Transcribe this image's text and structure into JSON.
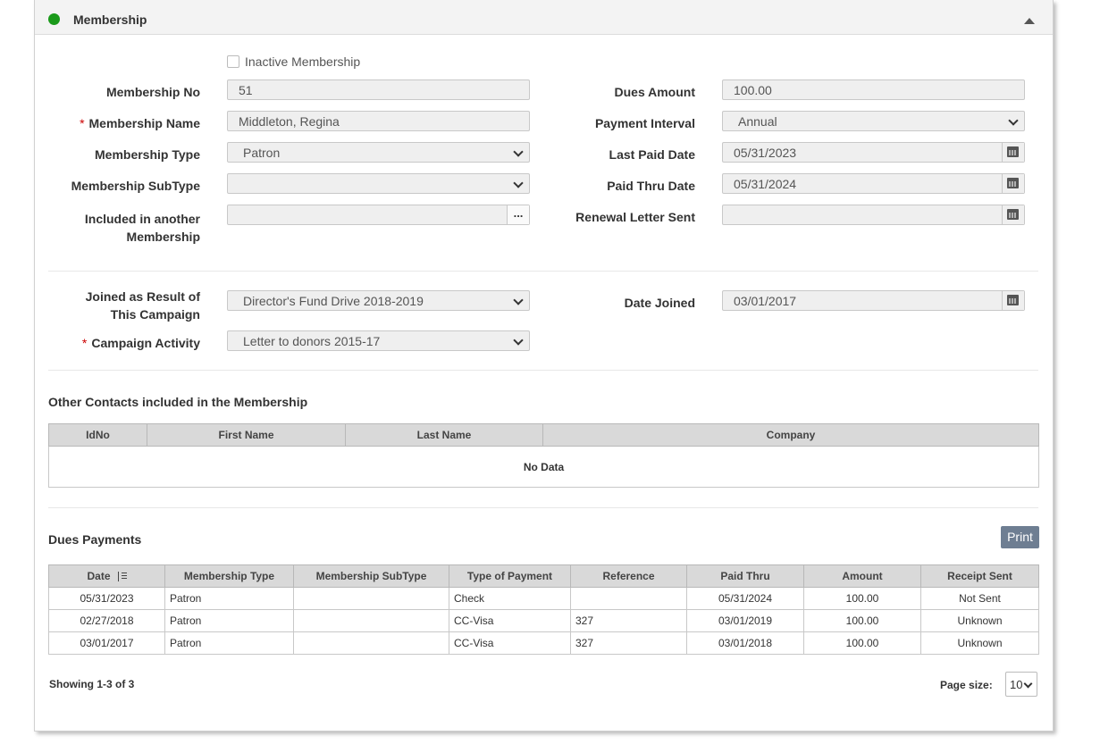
{
  "header": {
    "title": "Membership",
    "status_color": "#1a9a1a"
  },
  "form": {
    "inactive_label": "Inactive Membership",
    "membership_no_label": "Membership No",
    "membership_no": "51",
    "membership_name_label": "Membership Name",
    "membership_name": "Middleton, Regina",
    "membership_type_label": "Membership Type",
    "membership_type": "Patron",
    "membership_subtype_label": "Membership SubType",
    "membership_subtype": "",
    "included_label_1": "Included in another",
    "included_label_2": "Membership",
    "included": "",
    "dues_amount_label": "Dues Amount",
    "dues_amount": "100.00",
    "payment_interval_label": "Payment Interval",
    "payment_interval": "Annual",
    "last_paid_label": "Last Paid Date",
    "last_paid": "05/31/2023",
    "paid_thru_label": "Paid Thru Date",
    "paid_thru": "05/31/2024",
    "renewal_label": "Renewal Letter Sent",
    "renewal": "",
    "campaign_label_1": "Joined as Result of",
    "campaign_label_2": "This Campaign",
    "campaign": "Director's Fund Drive 2018-2019",
    "activity_label": "Campaign Activity",
    "activity": "Letter to donors 2015-17",
    "date_joined_label": "Date Joined",
    "date_joined": "03/01/2017",
    "required_mark": "*"
  },
  "contacts": {
    "title": "Other Contacts included in the Membership",
    "columns": [
      "IdNo",
      "First Name",
      "Last Name",
      "Company"
    ],
    "empty": "No Data"
  },
  "dues": {
    "title": "Dues Payments",
    "print_label": "Print",
    "columns": [
      "Date",
      "Membership Type",
      "Membership SubType",
      "Type of Payment",
      "Reference",
      "Paid Thru",
      "Amount",
      "Receipt Sent"
    ],
    "rows": [
      {
        "date": "05/31/2023",
        "type": "Patron",
        "subtype": "",
        "payment": "Check",
        "reference": "",
        "paid_thru": "05/31/2024",
        "amount": "100.00",
        "receipt": "Not Sent"
      },
      {
        "date": "02/27/2018",
        "type": "Patron",
        "subtype": "",
        "payment": "CC-Visa",
        "reference": "327",
        "paid_thru": "03/01/2019",
        "amount": "100.00",
        "receipt": "Unknown"
      },
      {
        "date": "03/01/2017",
        "type": "Patron",
        "subtype": "",
        "payment": "CC-Visa",
        "reference": "327",
        "paid_thru": "03/01/2018",
        "amount": "100.00",
        "receipt": "Unknown"
      }
    ],
    "showing": "Showing 1-3 of 3",
    "page_size_label": "Page size:",
    "page_size": "10"
  }
}
